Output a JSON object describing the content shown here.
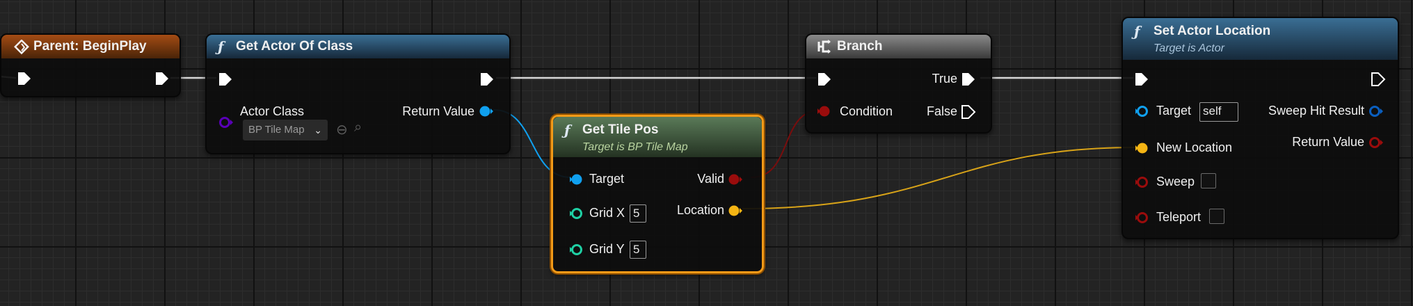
{
  "nodes": {
    "begin_play": {
      "title": "Parent: BeginPlay"
    },
    "get_actor_of_class": {
      "title": "Get Actor Of Class",
      "actor_class_label": "Actor Class",
      "actor_class_value": "BP Tile Map",
      "return_value_label": "Return Value"
    },
    "get_tile_pos": {
      "title": "Get Tile Pos",
      "subtitle": "Target is BP Tile Map",
      "target_label": "Target",
      "grid_x_label": "Grid X",
      "grid_x_value": "5",
      "grid_y_label": "Grid Y",
      "grid_y_value": "5",
      "valid_label": "Valid",
      "location_label": "Location"
    },
    "branch": {
      "title": "Branch",
      "condition_label": "Condition",
      "true_label": "True",
      "false_label": "False"
    },
    "set_actor_location": {
      "title": "Set Actor Location",
      "subtitle": "Target is Actor",
      "target_label": "Target",
      "target_value": "self",
      "new_location_label": "New Location",
      "sweep_label": "Sweep",
      "teleport_label": "Teleport",
      "sweep_hit_result_label": "Sweep Hit Result",
      "return_value_label": "Return Value"
    }
  },
  "icons": {
    "function": "function-icon",
    "event": "event-icon",
    "branch": "branch-icon",
    "exec_pin": "exec-pin-icon"
  },
  "colors": {
    "exec": "#ffffff",
    "object": "#10a0ef",
    "class": "#5a00b8",
    "bool": "#9a0c0c",
    "vector": "#f5b514",
    "int": "#1fd0a4",
    "hit_result": "#0a5fc0",
    "selection": "#f39a17"
  }
}
